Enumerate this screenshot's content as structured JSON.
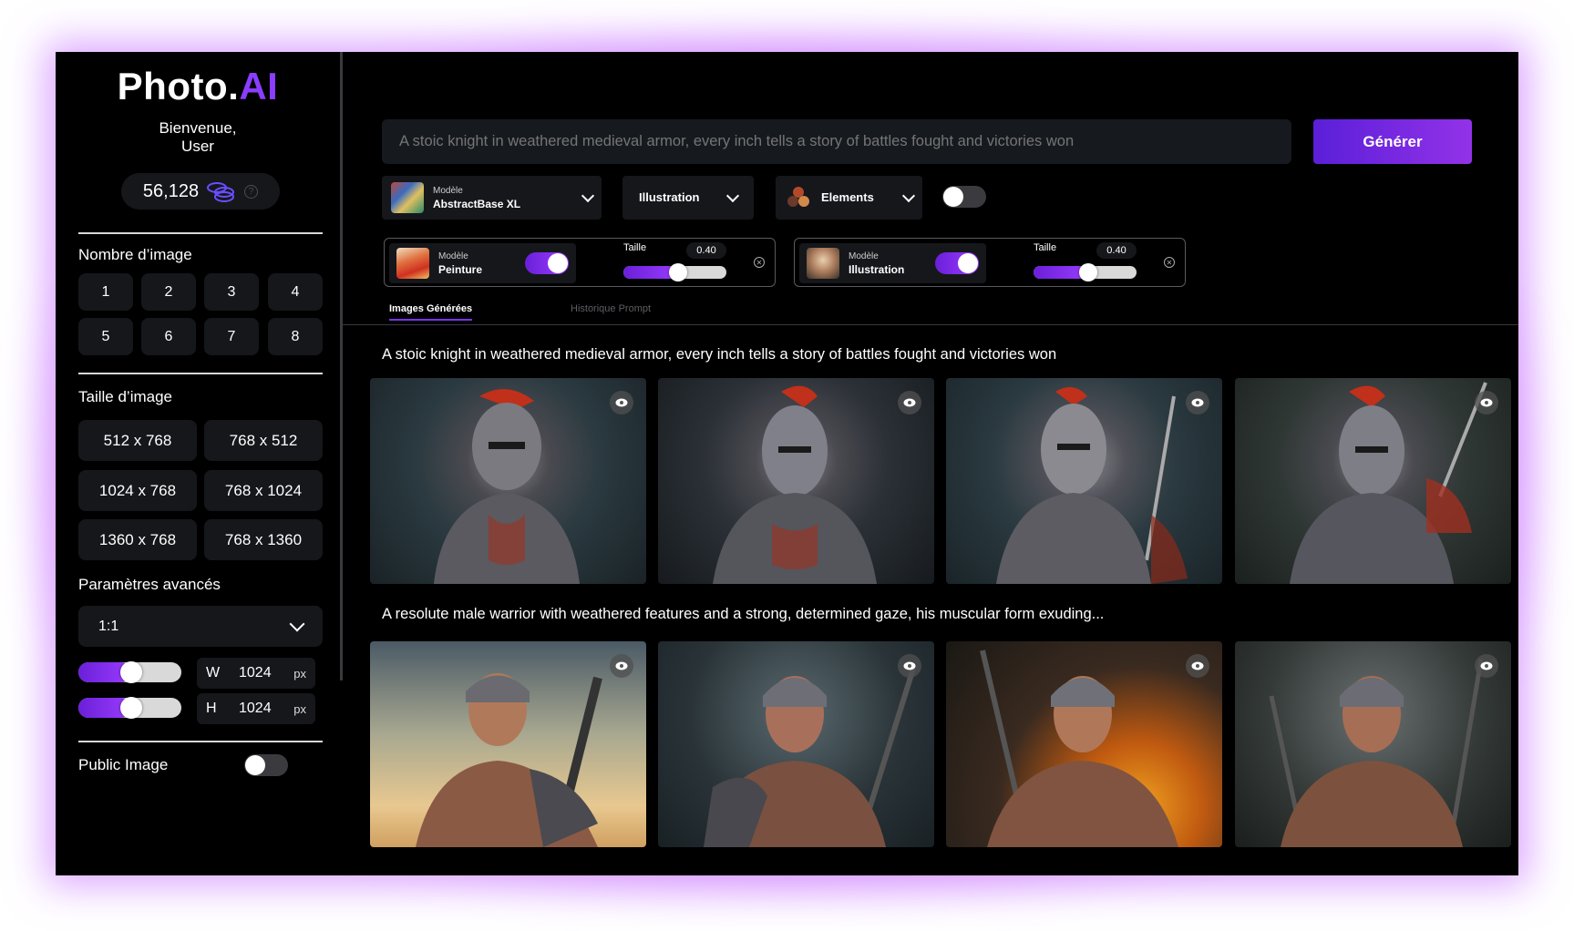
{
  "brand": {
    "name": "Photo.",
    "suffix": "AI"
  },
  "welcome": {
    "line1": "Bienvenue,",
    "line2": "User"
  },
  "credits": {
    "amount": "56,128",
    "help": "?"
  },
  "image_count": {
    "title": "Nombre d’image",
    "options": [
      "1",
      "2",
      "3",
      "4",
      "5",
      "6",
      "7",
      "8"
    ]
  },
  "image_size": {
    "title": "Taille d’image",
    "options": [
      "512 x 768",
      "768 x 512",
      "1024 x 768",
      "768 x 1024",
      "1360 x 768",
      "768 x 1360"
    ]
  },
  "advanced": {
    "title": "Paramètres avancés",
    "ratio": "1:1",
    "width": {
      "label": "W",
      "value": "1024",
      "unit": "px",
      "slider": 0.5
    },
    "height": {
      "label": "H",
      "value": "1024",
      "unit": "px",
      "slider": 0.5
    }
  },
  "public_image": {
    "label": "Public Image",
    "on": false
  },
  "prompt": {
    "placeholder": "A stoic knight in weathered medieval armor, every inch tells a story of battles fought and victories won"
  },
  "generate": {
    "label": "Générer"
  },
  "toolbar": {
    "model": {
      "small": "Modèle",
      "value": "AbstractBase XL"
    },
    "style": {
      "value": "Illustration"
    },
    "elements": {
      "value": "Elements"
    },
    "toggle_on": false
  },
  "loras": [
    {
      "small": "Modèle",
      "name": "Peinture",
      "size_label": "Taille",
      "size_value": "0.40",
      "enabled": true,
      "level": 0.55
    },
    {
      "small": "Modèle",
      "name": "Illustration",
      "size_label": "Taille",
      "size_value": "0.40",
      "enabled": true,
      "level": 0.55
    }
  ],
  "tabs": [
    {
      "label": "Images Générées",
      "active": true
    },
    {
      "label": "Historique Prompt",
      "active": false
    }
  ],
  "results": [
    {
      "prompt": "A stoic knight in weathered medieval armor, every inch tells a story of battles fought and victories won",
      "images": 4
    },
    {
      "prompt": "A resolute male warrior with weathered features and a strong, determined gaze, his muscular form exuding...",
      "images": 4
    }
  ],
  "colors": {
    "accent": "#8b3dff",
    "panel": "#16171b",
    "background": "#000000"
  }
}
